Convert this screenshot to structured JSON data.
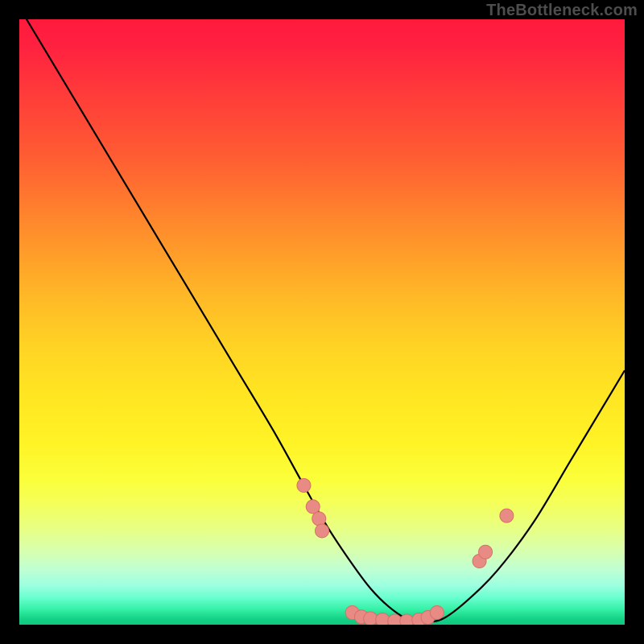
{
  "watermark": "TheBottleneck.com",
  "colors": {
    "dot_fill": "#e98b85",
    "dot_stroke": "#d86f68",
    "curve": "#000000"
  },
  "chart_data": {
    "type": "line",
    "title": "",
    "xlabel": "",
    "ylabel": "",
    "xlim": [
      0,
      100
    ],
    "ylim": [
      0,
      100
    ],
    "series": [
      {
        "name": "bottleneck-curve",
        "x": [
          0,
          6,
          12,
          18,
          24,
          30,
          36,
          42,
          47,
          51,
          55,
          58,
          61,
          64,
          67,
          70,
          74,
          79,
          85,
          91,
          97,
          100
        ],
        "y": [
          102,
          92,
          82,
          72,
          62,
          52,
          42,
          32,
          23,
          16,
          10,
          6,
          3,
          1,
          0.5,
          1,
          4,
          9,
          17,
          27,
          37,
          42
        ]
      }
    ],
    "points": [
      {
        "x": 47.0,
        "y": 23.0
      },
      {
        "x": 48.5,
        "y": 19.5
      },
      {
        "x": 49.5,
        "y": 17.5
      },
      {
        "x": 50.0,
        "y": 15.5
      },
      {
        "x": 55.0,
        "y": 2.0
      },
      {
        "x": 56.5,
        "y": 1.3
      },
      {
        "x": 58.0,
        "y": 1.0
      },
      {
        "x": 60.0,
        "y": 0.8
      },
      {
        "x": 62.0,
        "y": 0.6
      },
      {
        "x": 64.0,
        "y": 0.6
      },
      {
        "x": 66.0,
        "y": 0.8
      },
      {
        "x": 67.5,
        "y": 1.2
      },
      {
        "x": 69.0,
        "y": 2.0
      },
      {
        "x": 76.0,
        "y": 10.5
      },
      {
        "x": 77.0,
        "y": 12.0
      },
      {
        "x": 80.5,
        "y": 18.0
      }
    ]
  }
}
